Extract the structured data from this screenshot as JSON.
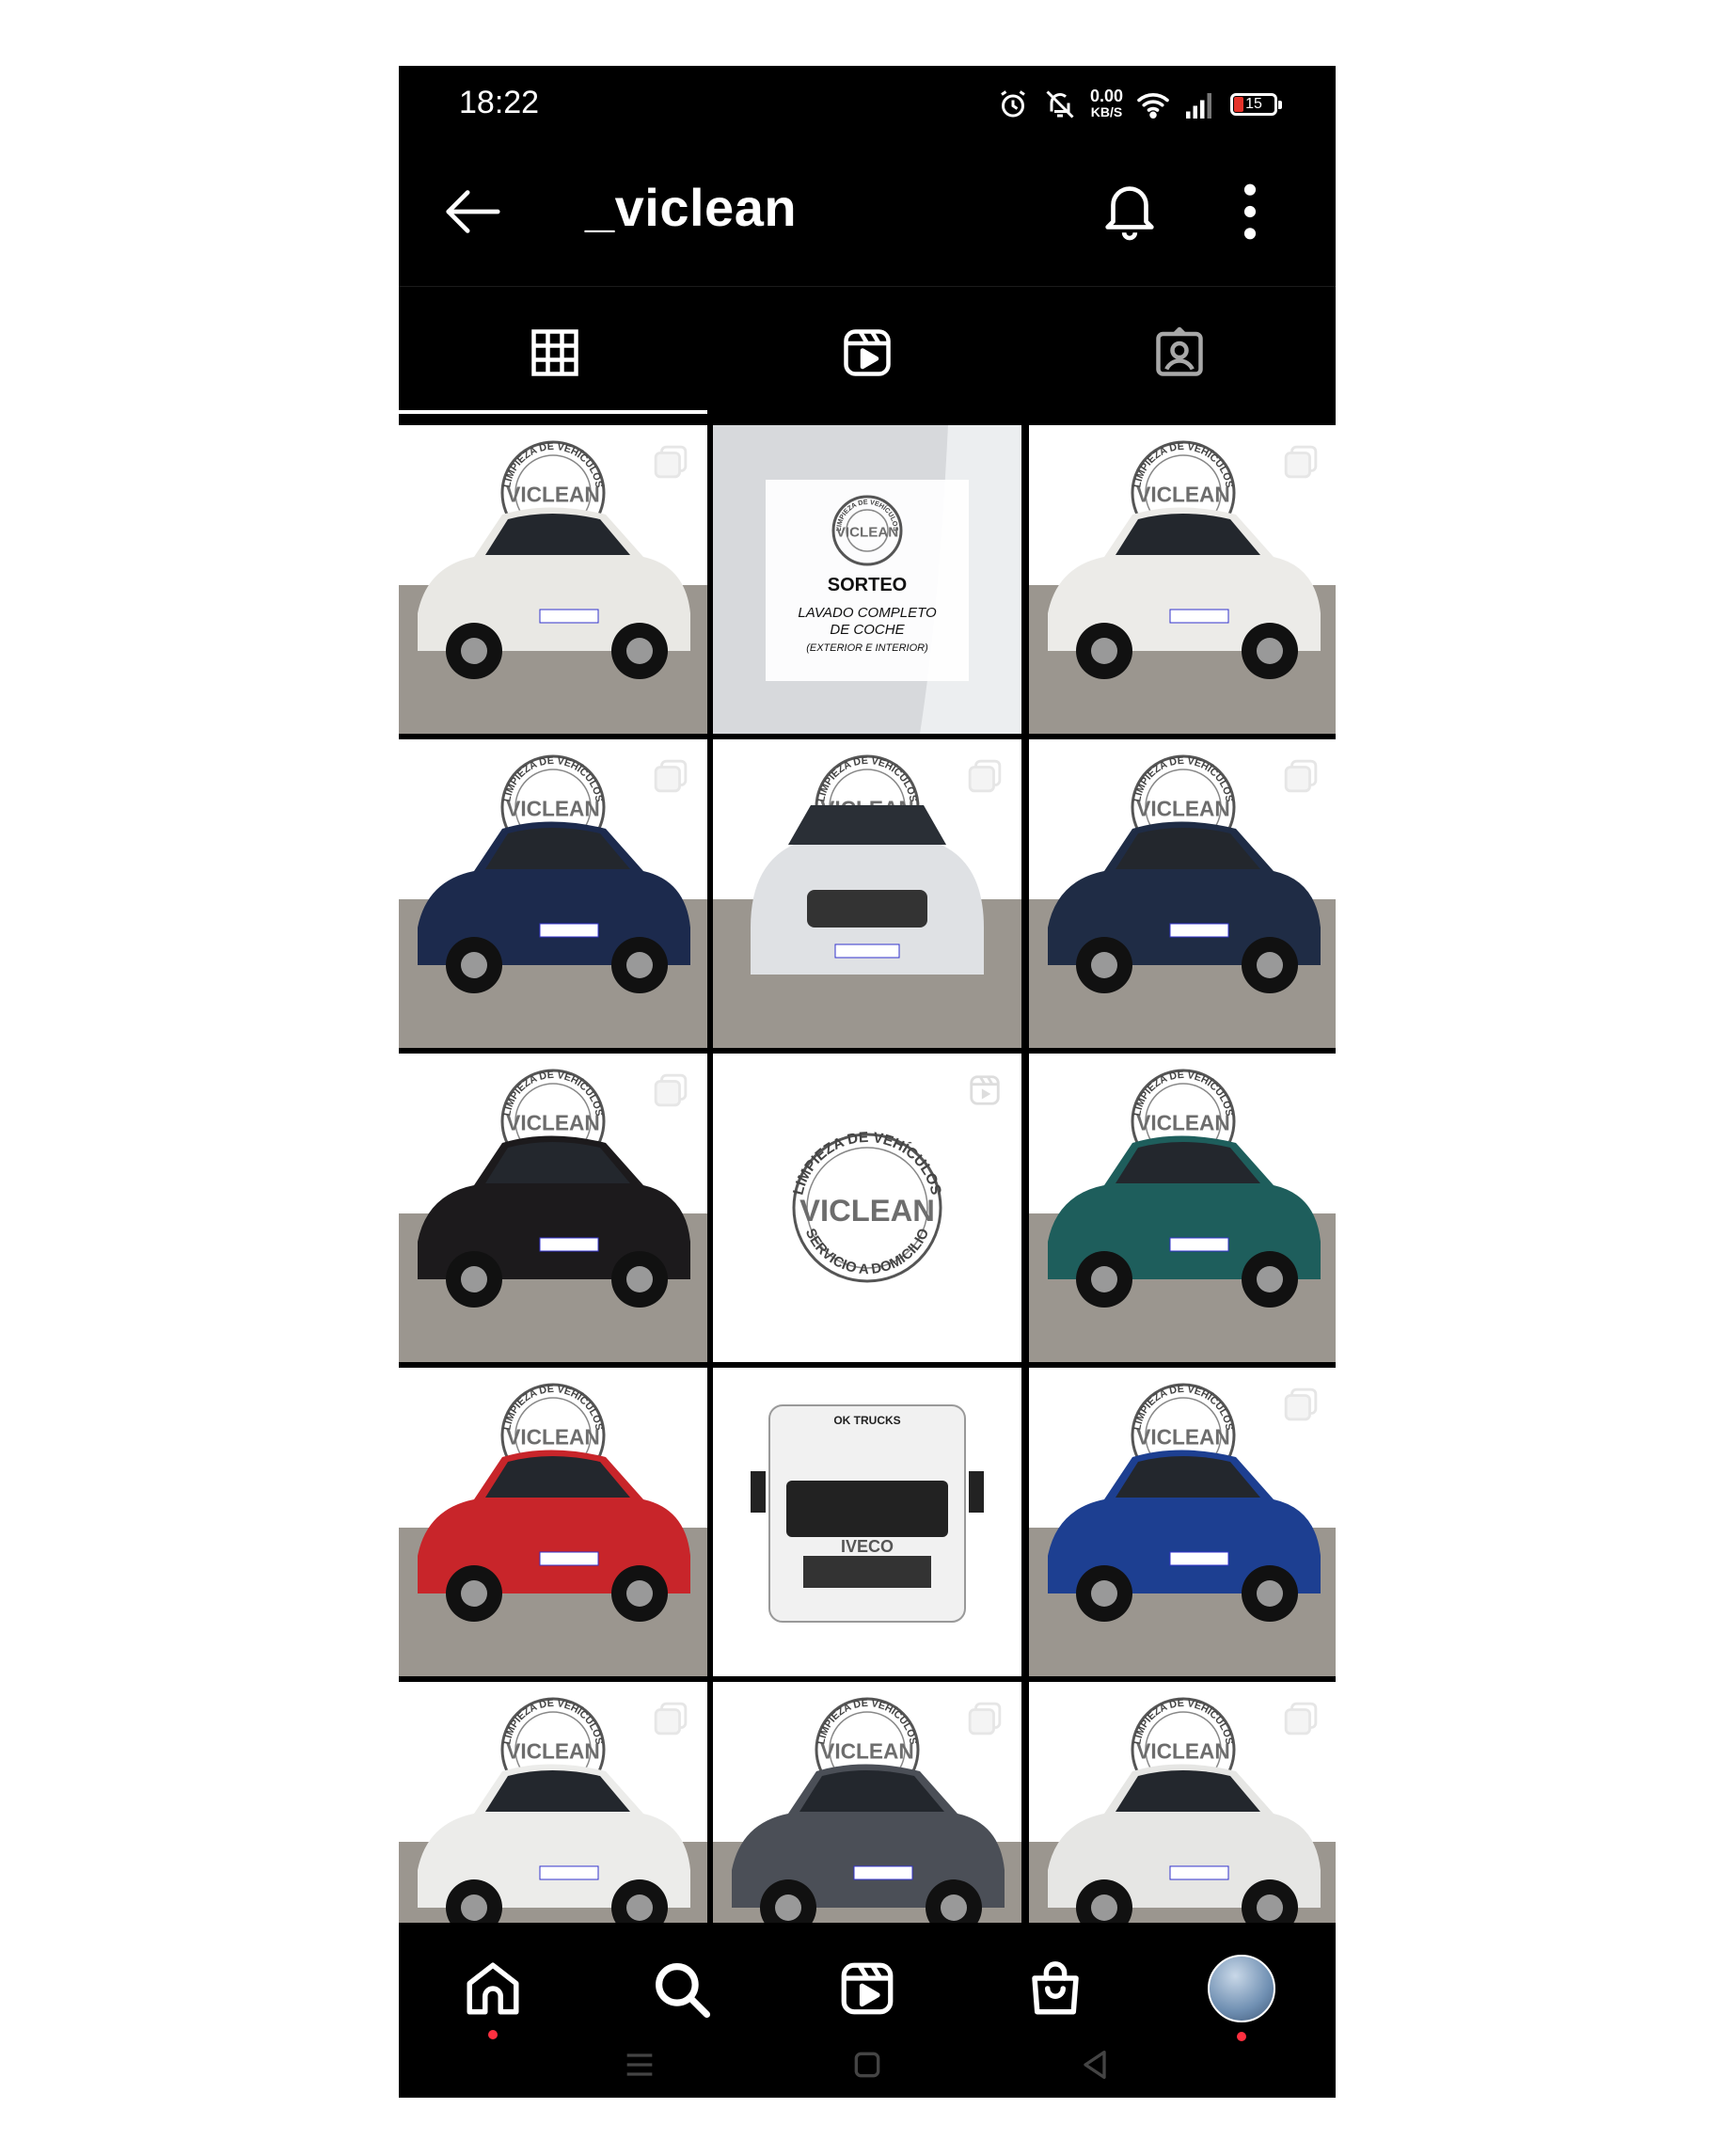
{
  "status_bar": {
    "time": "18:22",
    "net_speed_value": "0.00",
    "net_speed_unit": "KB/S",
    "battery_level": "15",
    "icons": [
      "alarm-icon",
      "mute-icon",
      "wifi-icon",
      "signal-icon",
      "battery-icon"
    ]
  },
  "header": {
    "username": "_viclean",
    "icons": [
      "back-arrow-icon",
      "bell-icon",
      "more-vertical-icon"
    ]
  },
  "tabs": [
    {
      "name": "posts",
      "icon": "grid-icon",
      "selected": true
    },
    {
      "name": "reels",
      "icon": "reels-icon",
      "selected": false
    },
    {
      "name": "tagged",
      "icon": "tagged-icon",
      "selected": false
    }
  ],
  "posts": [
    {
      "subject": "white SUV",
      "type": "carousel",
      "color": "#e9e8e4"
    },
    {
      "subject": "giveaway",
      "type": "image",
      "color": "#ffffff",
      "badge_text": "VICLEAN",
      "title": "SORTEO",
      "line1": "LAVADO COMPLETO",
      "line2": "DE COCHE",
      "line3": "(EXTERIOR E INTERIOR)"
    },
    {
      "subject": "white SUV",
      "type": "carousel",
      "color": "#ecebe8"
    },
    {
      "subject": "dark blue sedan",
      "type": "carousel",
      "color": "#1c2a4d"
    },
    {
      "subject": "silver SUV",
      "type": "carousel",
      "color": "#dfe1e4"
    },
    {
      "subject": "dark blue hatchback",
      "type": "carousel",
      "color": "#1f2c45"
    },
    {
      "subject": "black hatchback",
      "type": "carousel",
      "color": "#1c1a1c"
    },
    {
      "subject": "logo",
      "type": "reel",
      "color": "#ffffff"
    },
    {
      "subject": "green hatchback",
      "type": "image",
      "color": "#1e5e5c"
    },
    {
      "subject": "red hatchback",
      "type": "image",
      "color": "#c8252a"
    },
    {
      "subject": "white truck",
      "type": "image",
      "color": "#f1f1f1",
      "truck_top": "OK TRUCKS",
      "truck_brand": "IVECO"
    },
    {
      "subject": "blue coupe",
      "type": "carousel",
      "color": "#1d3f91"
    },
    {
      "subject": "white sedan",
      "type": "carousel",
      "color": "#ececea"
    },
    {
      "subject": "grey sedan",
      "type": "carousel",
      "color": "#4b4f57"
    },
    {
      "subject": "white sedan",
      "type": "carousel",
      "color": "#e6e6e4"
    }
  ],
  "logo": {
    "arc_top": "LIMPIEZA DE VEHÍCULOS",
    "brand": "VICLEAN",
    "arc_bottom": "SERVICIO A DOMICILIO"
  },
  "bottom_nav": [
    {
      "name": "home",
      "icon": "home-icon",
      "has_dot": true
    },
    {
      "name": "search",
      "icon": "search-icon",
      "has_dot": false
    },
    {
      "name": "reels",
      "icon": "reels-icon",
      "has_dot": false
    },
    {
      "name": "shop",
      "icon": "shop-bag-icon",
      "has_dot": false
    },
    {
      "name": "profile",
      "icon": "avatar",
      "has_dot": true
    }
  ],
  "system_nav": [
    "menu-icon",
    "home-square-icon",
    "back-triangle-icon"
  ]
}
